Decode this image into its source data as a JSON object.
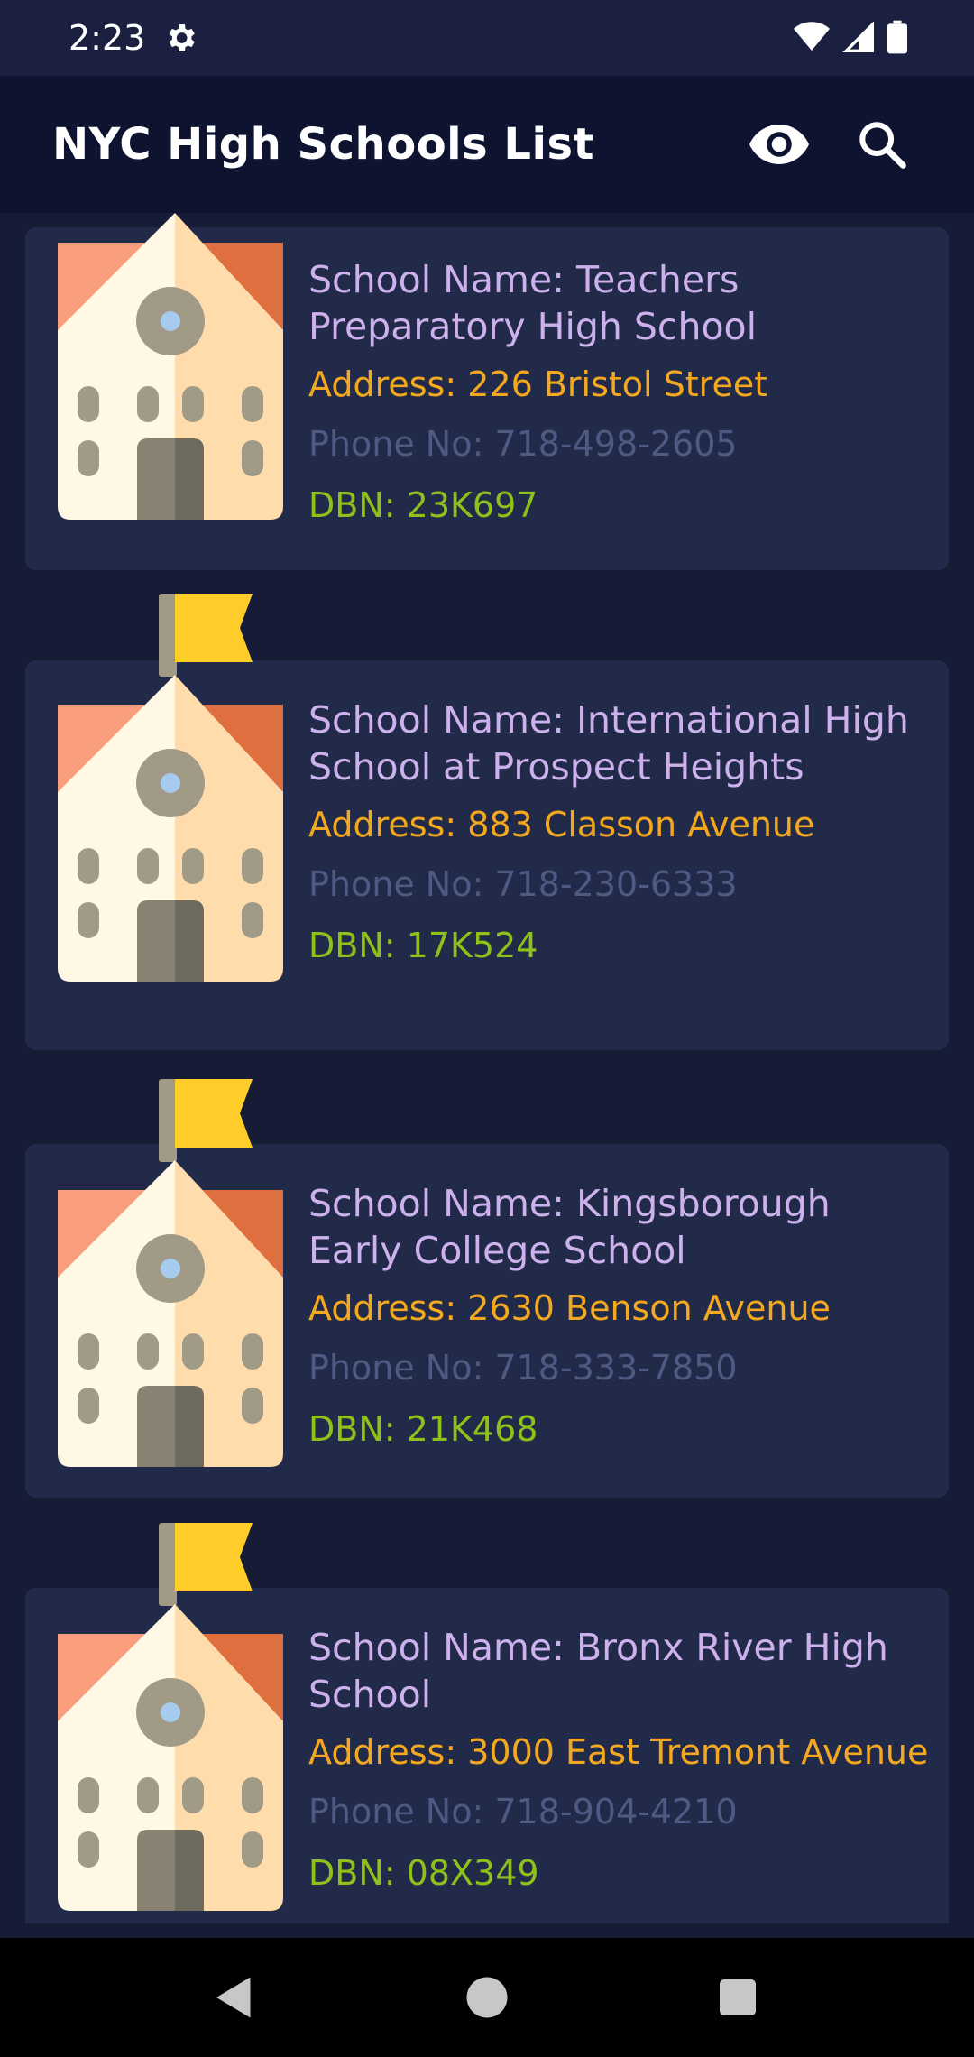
{
  "status_bar": {
    "time": "2:23"
  },
  "app_bar": {
    "title": "NYC High Schools List"
  },
  "schools": [
    {
      "name": "School Name: Teachers Preparatory High School",
      "address": "Address: 226 Bristol Street",
      "phone": "Phone No: 718-498-2605",
      "dbn": "DBN: 23K697"
    },
    {
      "name": "School Name: International High School at Prospect Heights",
      "address": "Address: 883 Classon Avenue",
      "phone": "Phone No: 718-230-6333",
      "dbn": "DBN: 17K524"
    },
    {
      "name": "School Name: Kingsborough Early College School",
      "address": "Address: 2630 Benson Avenue",
      "phone": "Phone No: 718-333-7850",
      "dbn": "DBN: 21K468"
    },
    {
      "name": "School Name: Bronx River High School",
      "address": "Address: 3000 East Tremont Avenue",
      "phone": "Phone No: 718-904-4210",
      "dbn": "DBN: 08X349"
    }
  ],
  "colors": {
    "background": "#171c36",
    "card": "#222a4a",
    "app_bar": "#0e1430",
    "name": "#cdb1ec",
    "address": "#f4a81f",
    "phone": "#4d5a82",
    "dbn": "#8ec21a"
  }
}
